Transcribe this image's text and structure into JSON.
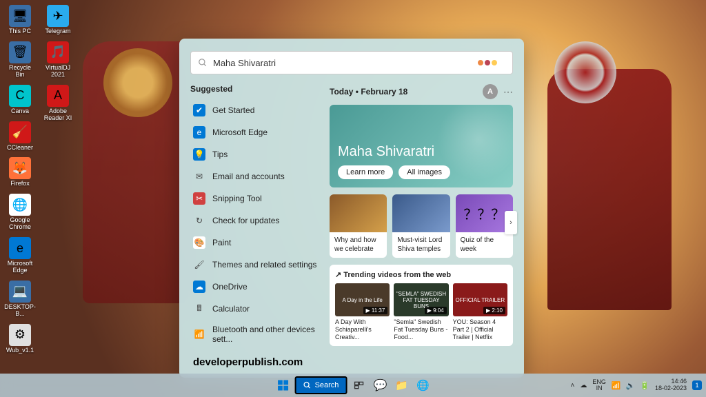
{
  "desktop": {
    "icons_col1": [
      {
        "label": "This PC",
        "bg": "#3a6ea5",
        "glyph": "🖥"
      },
      {
        "label": "Recycle Bin",
        "bg": "#3a6ea5",
        "glyph": "🗑"
      },
      {
        "label": "Canva",
        "bg": "#00c4cc",
        "glyph": "C"
      },
      {
        "label": "CCleaner",
        "bg": "#d01818",
        "glyph": "🧹"
      },
      {
        "label": "Firefox",
        "bg": "#ff7139",
        "glyph": "🦊"
      },
      {
        "label": "Google Chrome",
        "bg": "#fff",
        "glyph": "🌐"
      },
      {
        "label": "Microsoft Edge",
        "bg": "#0078d4",
        "glyph": "e"
      },
      {
        "label": "DESKTOP-B...",
        "bg": "#3a6ea5",
        "glyph": "💻"
      },
      {
        "label": "Wub_v1.1",
        "bg": "#e0e0e0",
        "glyph": "⚙"
      }
    ],
    "icons_col2": [
      {
        "label": "Telegram",
        "bg": "#2aabee",
        "glyph": "✈"
      },
      {
        "label": "VirtualDJ 2021",
        "bg": "#d01818",
        "glyph": "🎵"
      },
      {
        "label": "Adobe Reader XI",
        "bg": "#d01818",
        "glyph": "A"
      }
    ]
  },
  "search": {
    "placeholder": "Maha Shivaratri",
    "suggested_title": "Suggested",
    "items": [
      {
        "label": "Get Started",
        "bg": "#0078d4",
        "glyph": "✔"
      },
      {
        "label": "Microsoft Edge",
        "bg": "#0078d4",
        "glyph": "e"
      },
      {
        "label": "Tips",
        "bg": "#0078d4",
        "glyph": "💡"
      },
      {
        "label": "Email and accounts",
        "bg": "transparent",
        "glyph": "✉"
      },
      {
        "label": "Snipping Tool",
        "bg": "#d04040",
        "glyph": "✂"
      },
      {
        "label": "Check for updates",
        "bg": "transparent",
        "glyph": "↻"
      },
      {
        "label": "Paint",
        "bg": "#fff",
        "glyph": "🎨"
      },
      {
        "label": "Themes and related settings",
        "bg": "transparent",
        "glyph": "🖌"
      },
      {
        "label": "OneDrive",
        "bg": "#0078d4",
        "glyph": "☁"
      },
      {
        "label": "Calculator",
        "bg": "transparent",
        "glyph": "🖩"
      },
      {
        "label": "Bluetooth and other devices sett...",
        "bg": "transparent",
        "glyph": "📶"
      }
    ],
    "date_line": "Today  •  February 18",
    "avatar": "A",
    "hero": {
      "title": "Maha Shivaratri",
      "learn": "Learn more",
      "images": "All images"
    },
    "cards": [
      {
        "caption": "Why and how we celebrate",
        "bg": "linear-gradient(135deg,#8b5a2a,#d4a04a)"
      },
      {
        "caption": "Must-visit Lord Shiva temples",
        "bg": "linear-gradient(135deg,#3a5a8a,#7a9acc)"
      },
      {
        "caption": "Quiz of the week",
        "bg": "linear-gradient(135deg,#7a4ab8,#a878e0)"
      }
    ],
    "trending_title": "↗ Trending videos from the web",
    "videos": [
      {
        "caption": "A Day With Schiaparelli's Creativ...",
        "dur": "11:37",
        "thumb": "A Day in the Life",
        "bg": "#4a3a2a"
      },
      {
        "caption": "\"Semla\" Swedish Fat Tuesday Buns - Food...",
        "dur": "9:04",
        "thumb": "\"SEMLA\" SWEDISH FAT TUESDAY BUNS",
        "bg": "#2a3a2a"
      },
      {
        "caption": "YOU: Season 4 Part 2 | Official Trailer | Netflix",
        "dur": "2:10",
        "thumb": "OFFICIAL TRAILER",
        "bg": "#8a1a1a"
      }
    ]
  },
  "watermark": "developerpublish.com",
  "taskbar": {
    "search_label": "Search",
    "lang1": "ENG",
    "lang2": "IN",
    "time": "14:46",
    "date": "18-02-2023",
    "notif": "1"
  }
}
